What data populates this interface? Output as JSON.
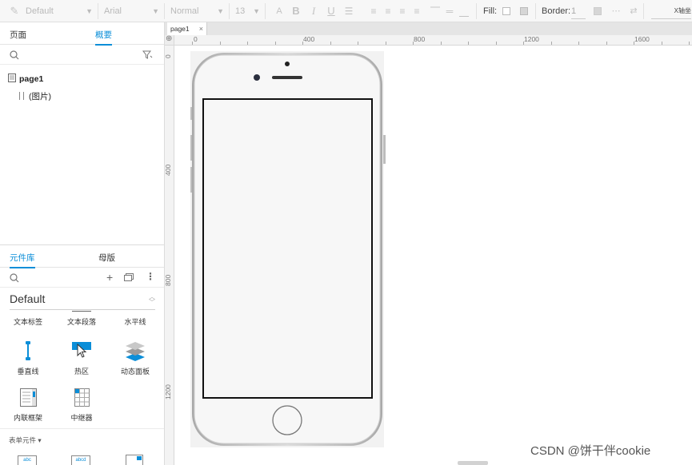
{
  "toolbar": {
    "style": "Default",
    "font": "Arial",
    "weight": "Normal",
    "size": "13",
    "fill_label": "Fill:",
    "border_label": "Border:",
    "border_value": "1",
    "x_label": "X轴坐"
  },
  "left_top": {
    "tab_pages": "页面",
    "tab_outline": "概要",
    "tree": [
      {
        "label": "page1"
      },
      {
        "label": "(图片)"
      }
    ]
  },
  "left_bottom": {
    "tab_library": "元件库",
    "tab_masters": "母版",
    "library_name": "Default",
    "widgets": [
      {
        "label": "文本标签",
        "icon": "text-label-icon"
      },
      {
        "label": "文本段落",
        "icon": "paragraph-icon"
      },
      {
        "label": "水平线",
        "icon": "horizontal-line-icon"
      },
      {
        "label": "垂直线",
        "icon": "vertical-line-icon"
      },
      {
        "label": "热区",
        "icon": "hotspot-icon"
      },
      {
        "label": "动态面板",
        "icon": "dynamic-panel-icon"
      },
      {
        "label": "内联框架",
        "icon": "inline-frame-icon"
      },
      {
        "label": "中继器",
        "icon": "repeater-icon"
      }
    ],
    "section_forms": "表单元件 ▾"
  },
  "canvas": {
    "page_tab": "page1",
    "ruler_h": [
      "0",
      "400",
      "800",
      "1200",
      "1600"
    ],
    "ruler_v": [
      "0",
      "400",
      "800",
      "1200"
    ]
  },
  "watermark": "CSDN @饼干伴cookie",
  "colors": {
    "accent": "#0b8ed8",
    "toolbar_bg": "#f7f7f7"
  }
}
